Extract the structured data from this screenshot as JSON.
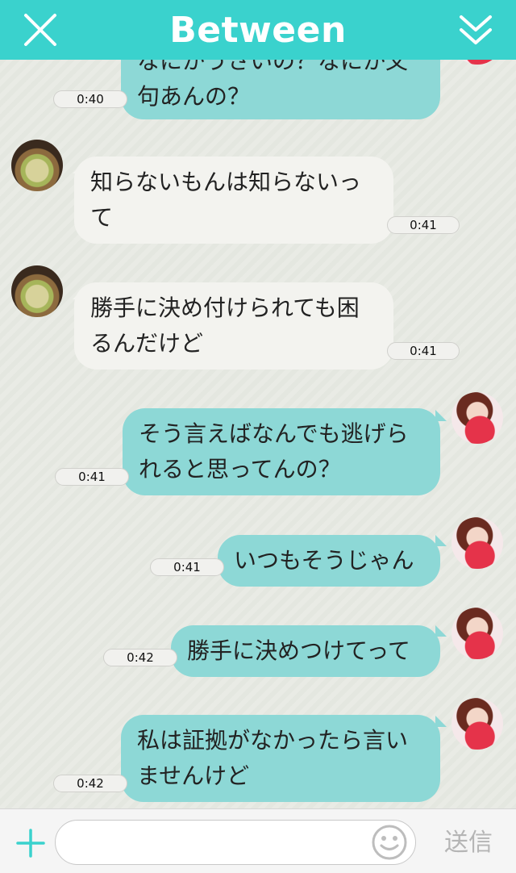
{
  "header": {
    "title": "Between",
    "close_icon": "close-icon",
    "collapse_icon": "double-chevron-down-icon"
  },
  "messages": [
    {
      "dir": "out",
      "lines": [
        "なにかうさいの？なにか文",
        "句あんの？"
      ],
      "time": "0:40"
    },
    {
      "dir": "in",
      "lines": [
        "知らないもんは知らないっ",
        "て"
      ],
      "time": "0:41"
    },
    {
      "dir": "in",
      "lines": [
        "勝手に決め付けられても困",
        "るんだけど"
      ],
      "time": "0:41"
    },
    {
      "dir": "out",
      "lines": [
        "そう言えばなんでも逃げら",
        "れると思ってんの？"
      ],
      "time": "0:41"
    },
    {
      "dir": "out",
      "lines": [
        "いつもそうじゃん"
      ],
      "time": "0:41"
    },
    {
      "dir": "out",
      "lines": [
        "勝手に決めつけてって"
      ],
      "time": "0:42"
    },
    {
      "dir": "out",
      "lines": [
        "私は証拠がなかったら言い",
        "ませんけど"
      ],
      "time": "0:42"
    }
  ],
  "input": {
    "plus_icon": "plus-icon",
    "value": "",
    "placeholder": "",
    "emoji_icon": "smiley-icon",
    "send_label": "送信"
  },
  "colors": {
    "header": "#3ad2cd",
    "bubble_out": "#8dd8d6",
    "bubble_in": "#f3f3ef"
  }
}
